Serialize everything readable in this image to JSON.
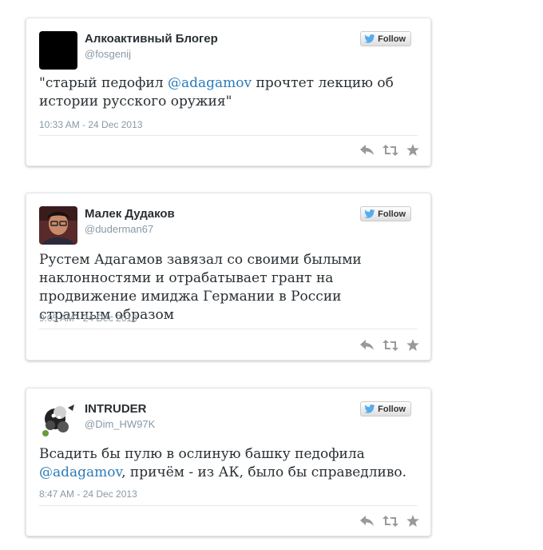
{
  "follow_label": "Follow",
  "tweets": [
    {
      "name": "Алкоактивный Блогер",
      "handle": "@fosgenij",
      "text_before": "\"старый педофил ",
      "mention": "@adagamov",
      "text_after": " прочтет лекцию об истории русского оружия\"",
      "date": "10:33 AM - 24 Dec 2013",
      "avatar_icon": "black-square-avatar"
    },
    {
      "name": "Малек Дудаков",
      "handle": "@duderman67",
      "text": "Рустем Адагамов завязал со своими былыми наклонностями и отрабатывает грант на продвижение имиджа Германии в России странным образом",
      "date": "9:05 AM - 24 Dec 2013",
      "avatar_icon": "person-photo-avatar"
    },
    {
      "name": "INTRUDER",
      "handle": "@Dim_HW97K",
      "text_before": "Всадить бы пулю в ослиную башку педофила ",
      "mention": "@adagamov",
      "text_after": ", причём - из АК, было бы справедливо.",
      "date": "8:47 AM - 24 Dec 2013",
      "avatar_icon": "cartoon-logo-avatar"
    }
  ],
  "colors": {
    "link": "#2b7bb9",
    "name": "#292f33",
    "meta": "#8899a6",
    "twitter_bird": "#55acee",
    "action_icon": "#999999"
  }
}
